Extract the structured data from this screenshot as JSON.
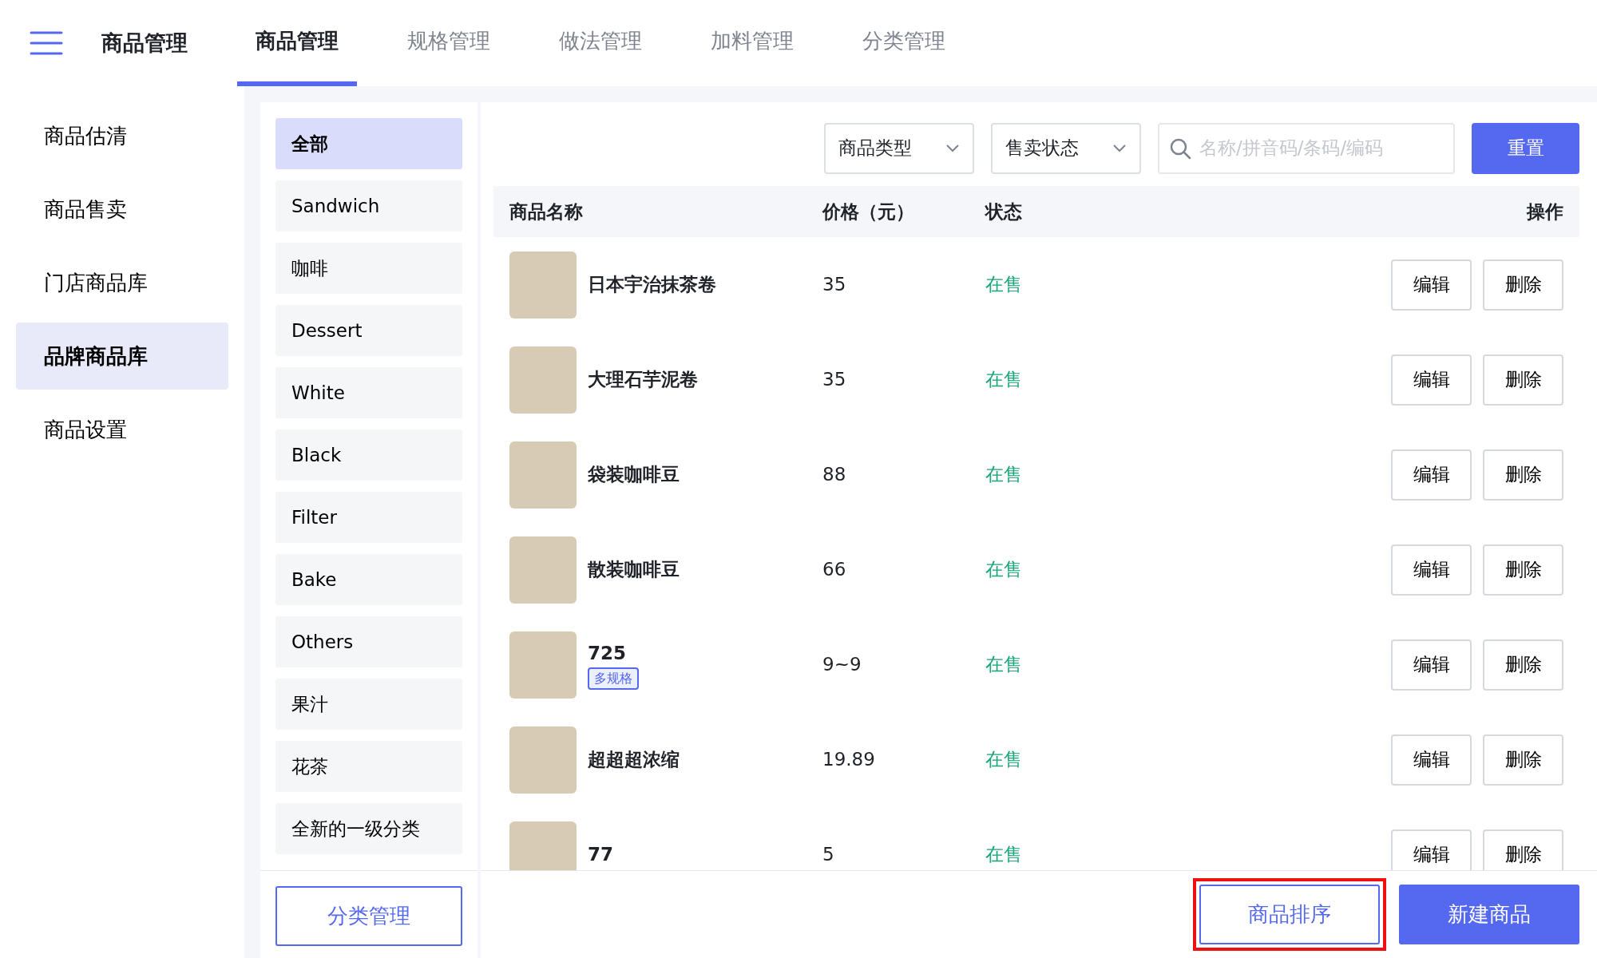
{
  "header": {
    "title": "商品管理"
  },
  "tabs": [
    {
      "label": "商品管理",
      "selected": true
    },
    {
      "label": "规格管理",
      "selected": false
    },
    {
      "label": "做法管理",
      "selected": false
    },
    {
      "label": "加料管理",
      "selected": false
    },
    {
      "label": "分类管理",
      "selected": false
    }
  ],
  "sidebar": {
    "items": [
      {
        "label": "商品估清",
        "selected": false
      },
      {
        "label": "商品售卖",
        "selected": false
      },
      {
        "label": "门店商品库",
        "selected": false
      },
      {
        "label": "品牌商品库",
        "selected": true
      },
      {
        "label": "商品设置",
        "selected": false
      }
    ]
  },
  "categories": {
    "items": [
      {
        "label": "全部",
        "selected": true
      },
      {
        "label": "Sandwich",
        "selected": false
      },
      {
        "label": "咖啡",
        "selected": false
      },
      {
        "label": "Dessert",
        "selected": false
      },
      {
        "label": "White",
        "selected": false
      },
      {
        "label": "Black",
        "selected": false
      },
      {
        "label": "Filter",
        "selected": false
      },
      {
        "label": "Bake",
        "selected": false
      },
      {
        "label": "Others",
        "selected": false
      },
      {
        "label": "果汁",
        "selected": false
      },
      {
        "label": "花茶",
        "selected": false
      },
      {
        "label": "全新的一级分类",
        "selected": false
      }
    ],
    "manage_button": "分类管理"
  },
  "filters": {
    "type_select": "商品类型",
    "status_select": "售卖状态",
    "search": {
      "placeholder": "名称/拼音码/条码/编码"
    },
    "reset_button": "重置"
  },
  "table": {
    "columns": [
      "商品名称",
      "价格（元）",
      "状态",
      "操作"
    ],
    "rows": [
      {
        "name": "日本宇治抹茶卷",
        "price": "35",
        "status": "在售",
        "edit": "编辑",
        "delete": "删除"
      },
      {
        "name": "大理石芋泥卷",
        "price": "35",
        "status": "在售",
        "edit": "编辑",
        "delete": "删除"
      },
      {
        "name": "袋装咖啡豆",
        "price": "88",
        "status": "在售",
        "edit": "编辑",
        "delete": "删除"
      },
      {
        "name": "散装咖啡豆",
        "price": "66",
        "status": "在售",
        "edit": "编辑",
        "delete": "删除"
      },
      {
        "name": "725",
        "tag": "多规格",
        "price": "9~9",
        "status": "在售",
        "edit": "编辑",
        "delete": "删除"
      },
      {
        "name": "超超超浓缩",
        "price": "19.89",
        "status": "在售",
        "edit": "编辑",
        "delete": "删除"
      },
      {
        "name": "77",
        "price": "5",
        "status": "在售",
        "edit": "编辑",
        "delete": "删除"
      }
    ]
  },
  "footer": {
    "sort_button": {
      "label": "商品排序",
      "highlighted": true
    },
    "new_button": "新建商品"
  }
}
